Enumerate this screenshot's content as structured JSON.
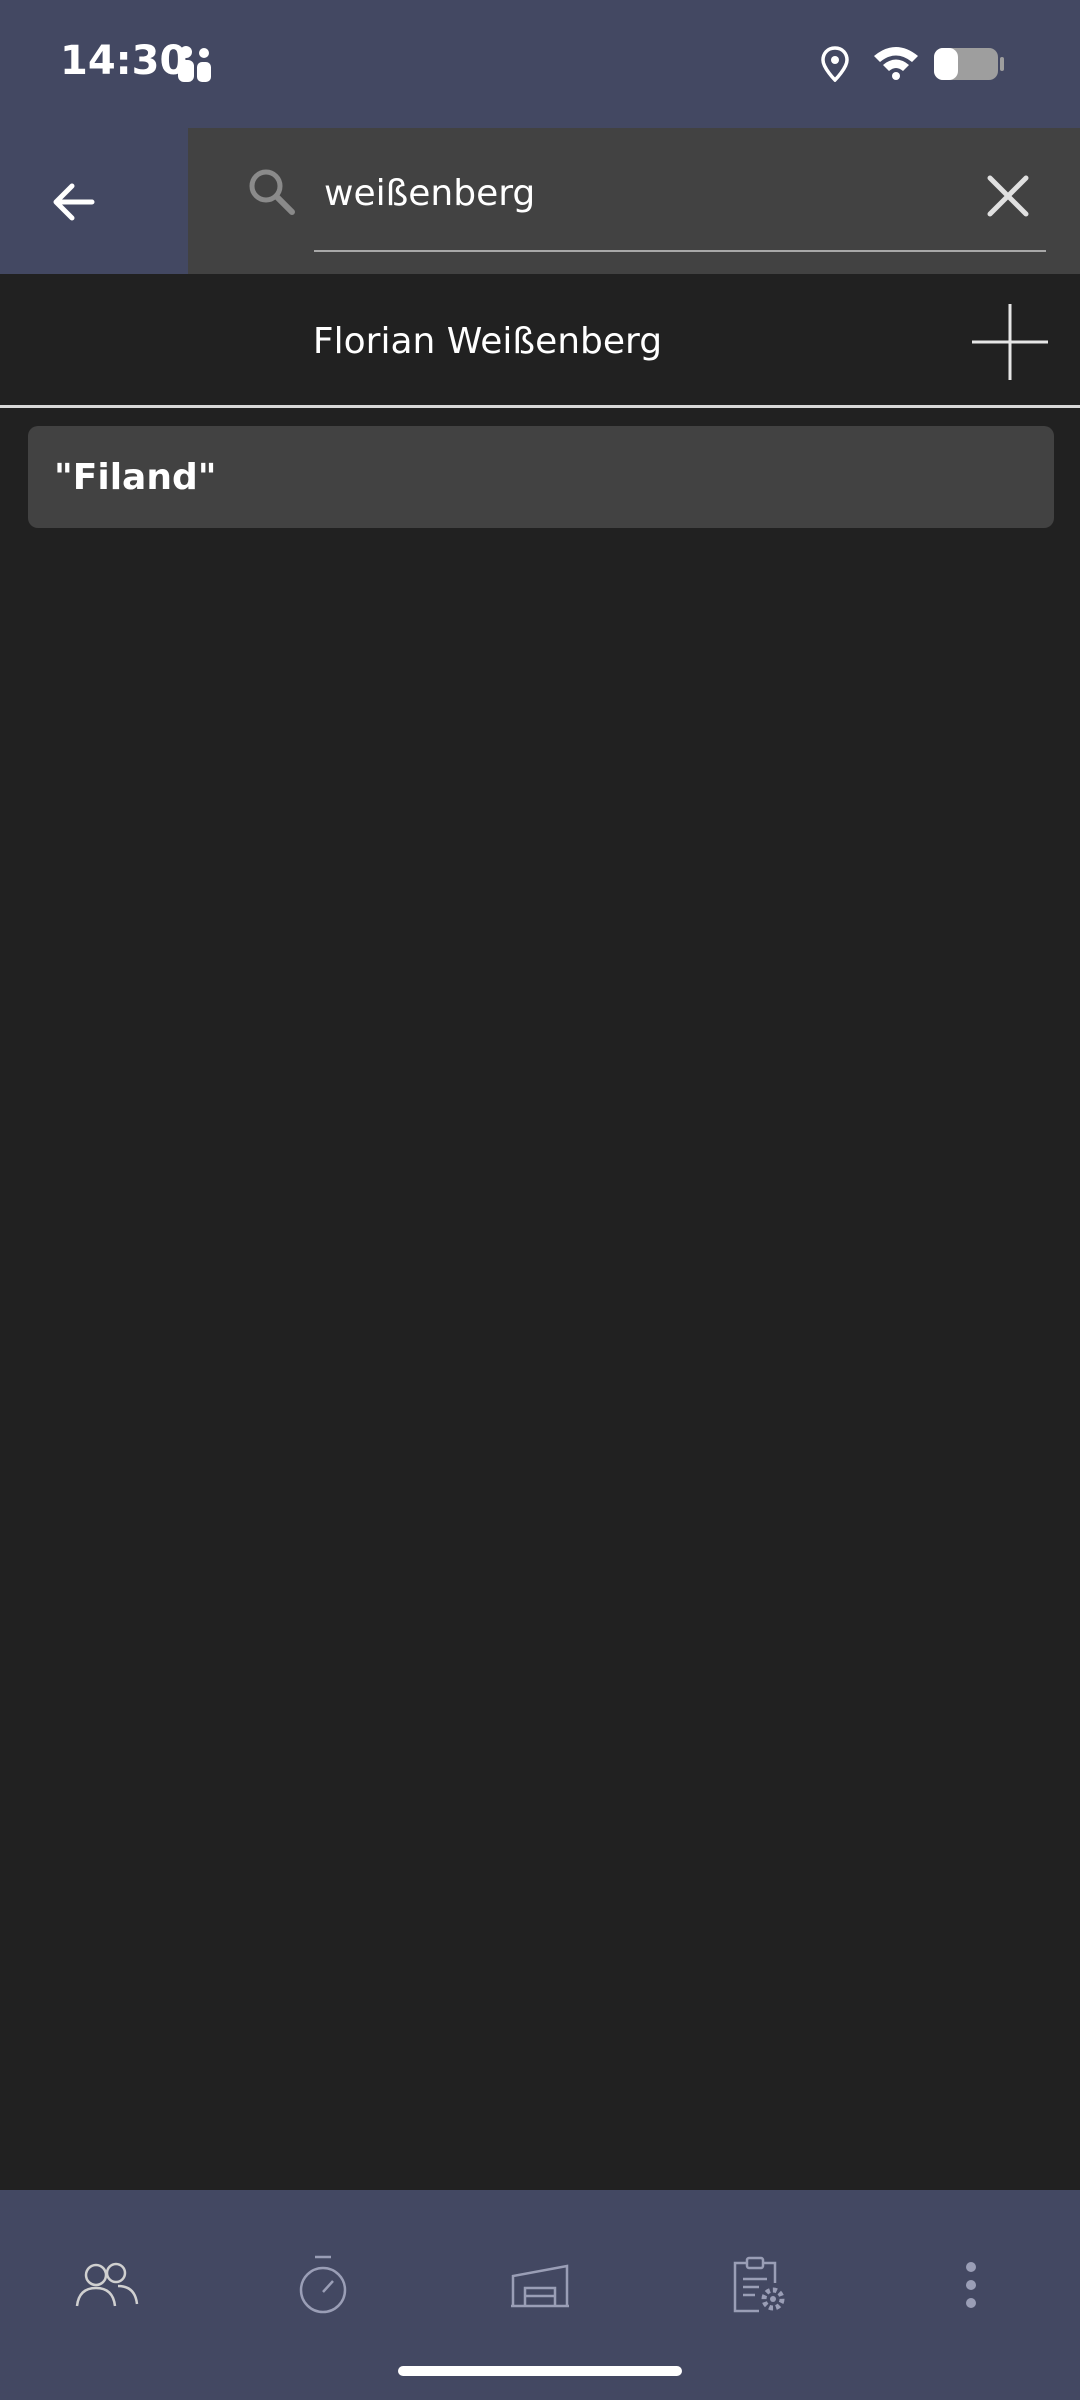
{
  "status_bar": {
    "time": "14:30",
    "icons": [
      "teams-icon",
      "location-icon",
      "wifi-icon",
      "battery-icon"
    ]
  },
  "search": {
    "value": "weißenberg",
    "back_icon": "arrow-left-icon",
    "search_icon": "search-icon",
    "clear_icon": "close-icon"
  },
  "result": {
    "name": "Florian Weißenberg",
    "add_icon": "plus-icon"
  },
  "list": {
    "items": [
      {
        "label": "\"Filand\""
      }
    ]
  },
  "bottom_nav": {
    "items": [
      {
        "icon": "people-icon"
      },
      {
        "icon": "stopwatch-icon"
      },
      {
        "icon": "warehouse-icon"
      },
      {
        "icon": "clipboard-settings-icon"
      },
      {
        "icon": "more-vertical-icon"
      }
    ]
  },
  "colors": {
    "header_bar": "#434862",
    "background": "#212121",
    "surface": "#424242",
    "text": "#ffffff"
  }
}
